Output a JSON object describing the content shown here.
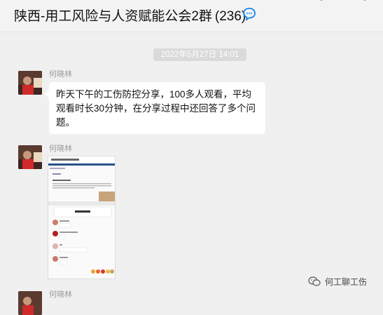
{
  "window": {
    "title": "陕西-用工风险与人资赋能公会2群",
    "member_count": "(236)"
  },
  "icons": {
    "chat_info": "chat-bubble-icon",
    "top_left": "minimize-icon",
    "top_right": "more-icon"
  },
  "messages": {
    "timestamp": "2022年5月27日  14:01",
    "items": [
      {
        "sender": "何晓林",
        "text": "昨天下午的工伤防控分享，100多人观看，平均观看时长30分钟，在分享过程中还回答了多个问题。"
      },
      {
        "sender": "何晓林"
      },
      {
        "sender": "何晓林"
      }
    ]
  },
  "image_preview": {
    "header_text": "T 工伤 · 人会交流群",
    "card_title": "用工风险",
    "lines": [
      "中山公开",
      "吉",
      "晓"
    ]
  },
  "watermark": {
    "text": "何工聊工伤"
  },
  "colors": {
    "background": "#f0f0f0",
    "bubble": "#ffffff",
    "timestamp_bg": "#dadada",
    "accent": "#1485ee"
  }
}
